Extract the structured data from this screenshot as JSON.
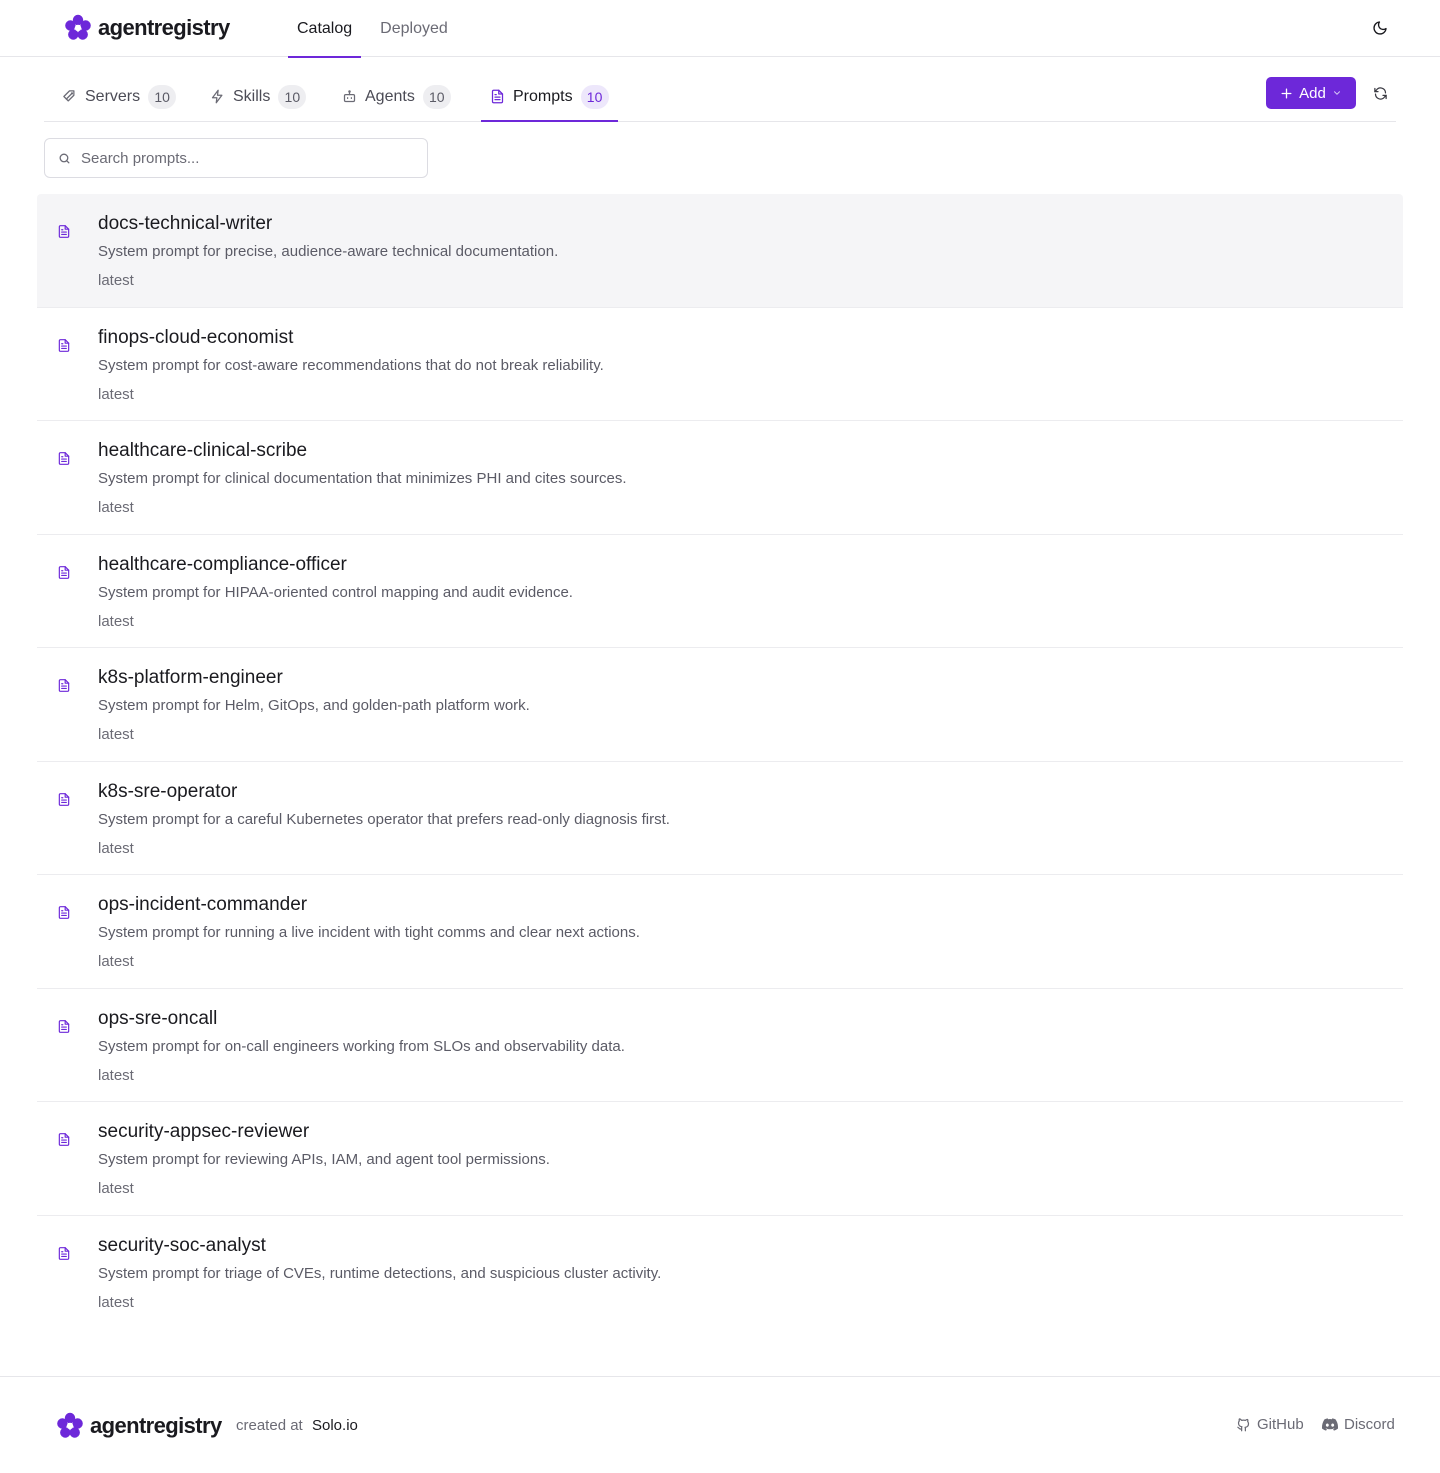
{
  "brand": {
    "name": "agentregistry",
    "accent": "#6d28d9"
  },
  "topnav": {
    "items": [
      {
        "label": "Catalog",
        "active": true
      },
      {
        "label": "Deployed",
        "active": false
      }
    ]
  },
  "tabs": [
    {
      "label": "Servers",
      "count": "10",
      "icon": "server-tag-icon"
    },
    {
      "label": "Skills",
      "count": "10",
      "icon": "bolt-icon"
    },
    {
      "label": "Agents",
      "count": "10",
      "icon": "bot-icon"
    },
    {
      "label": "Prompts",
      "count": "10",
      "icon": "document-icon",
      "active": true
    }
  ],
  "actions": {
    "add_label": "Add"
  },
  "search": {
    "placeholder": "Search prompts..."
  },
  "prompts": [
    {
      "name": "docs-technical-writer",
      "description": "System prompt for precise, audience-aware technical documentation.",
      "version": "latest"
    },
    {
      "name": "finops-cloud-economist",
      "description": "System prompt for cost-aware recommendations that do not break reliability.",
      "version": "latest"
    },
    {
      "name": "healthcare-clinical-scribe",
      "description": "System prompt for clinical documentation that minimizes PHI and cites sources.",
      "version": "latest"
    },
    {
      "name": "healthcare-compliance-officer",
      "description": "System prompt for HIPAA-oriented control mapping and audit evidence.",
      "version": "latest"
    },
    {
      "name": "k8s-platform-engineer",
      "description": "System prompt for Helm, GitOps, and golden-path platform work.",
      "version": "latest"
    },
    {
      "name": "k8s-sre-operator",
      "description": "System prompt for a careful Kubernetes operator that prefers read-only diagnosis first.",
      "version": "latest"
    },
    {
      "name": "ops-incident-commander",
      "description": "System prompt for running a live incident with tight comms and clear next actions.",
      "version": "latest"
    },
    {
      "name": "ops-sre-oncall",
      "description": "System prompt for on-call engineers working from SLOs and observability data.",
      "version": "latest"
    },
    {
      "name": "security-appsec-reviewer",
      "description": "System prompt for reviewing APIs, IAM, and agent tool permissions.",
      "version": "latest"
    },
    {
      "name": "security-soc-analyst",
      "description": "System prompt for triage of CVEs, runtime detections, and suspicious cluster activity.",
      "version": "latest"
    }
  ],
  "footer": {
    "created_at": "created at",
    "company": "Solo.io",
    "github": "GitHub",
    "discord": "Discord"
  }
}
